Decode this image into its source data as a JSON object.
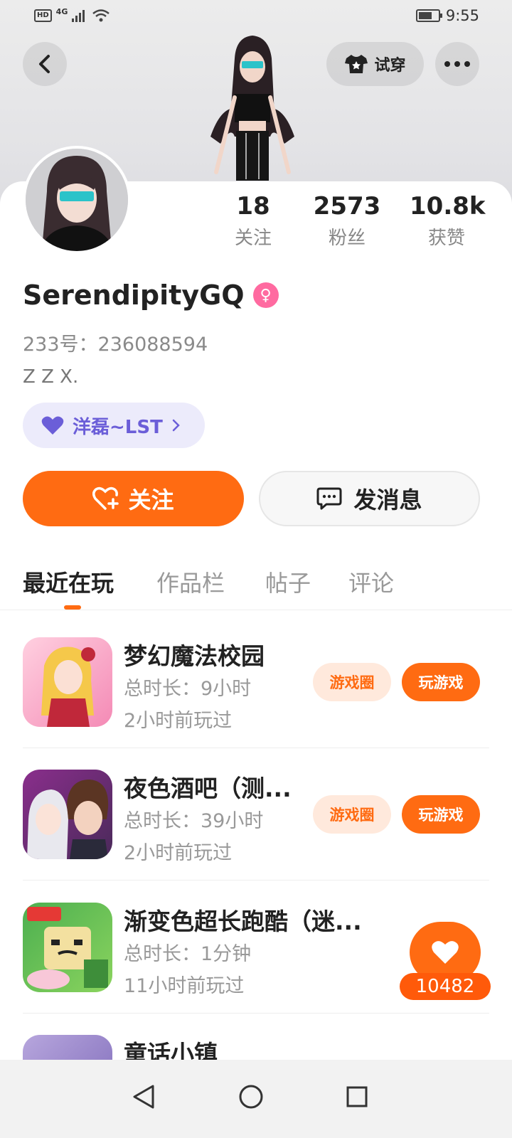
{
  "status_bar": {
    "network": "4G",
    "hd": "HD",
    "time": "9:55"
  },
  "header": {
    "try_on_label": "试穿"
  },
  "profile": {
    "stats": [
      {
        "value": "18",
        "label": "关注"
      },
      {
        "value": "2573",
        "label": "粉丝"
      },
      {
        "value": "10.8k",
        "label": "获赞"
      }
    ],
    "username": "SerendipityGQ",
    "gender_symbol": "♀",
    "uid": "233号：236088594",
    "bio": "Z Z X.",
    "tag_label": "洋磊~LST",
    "follow_label": "关注",
    "message_label": "发消息"
  },
  "tabs": [
    "最近在玩",
    "作品栏",
    "帖子",
    "评论"
  ],
  "games": [
    {
      "name": "梦幻魔法校园",
      "duration": "总时长：9小时",
      "last_played": "2小时前玩过",
      "circle_label": "游戏圈",
      "play_label": "玩游戏",
      "color": "#f48ab5"
    },
    {
      "name": "夜色酒吧（测...",
      "duration": "总时长：39小时",
      "last_played": "2小时前玩过",
      "circle_label": "游戏圈",
      "play_label": "玩游戏",
      "color": "#7a4b8a"
    },
    {
      "name": "渐变色超长跑酷（迷...",
      "duration": "总时长：1分钟",
      "last_played": "11小时前玩过",
      "color": "#7fc25a"
    },
    {
      "name": "童话小镇",
      "color": "#9a86c6"
    }
  ],
  "floating_like": {
    "count": "10482"
  },
  "colors": {
    "accent": "#ff6b12",
    "tag_bg": "#ecebfb",
    "tag_text": "#6b5ed8"
  }
}
